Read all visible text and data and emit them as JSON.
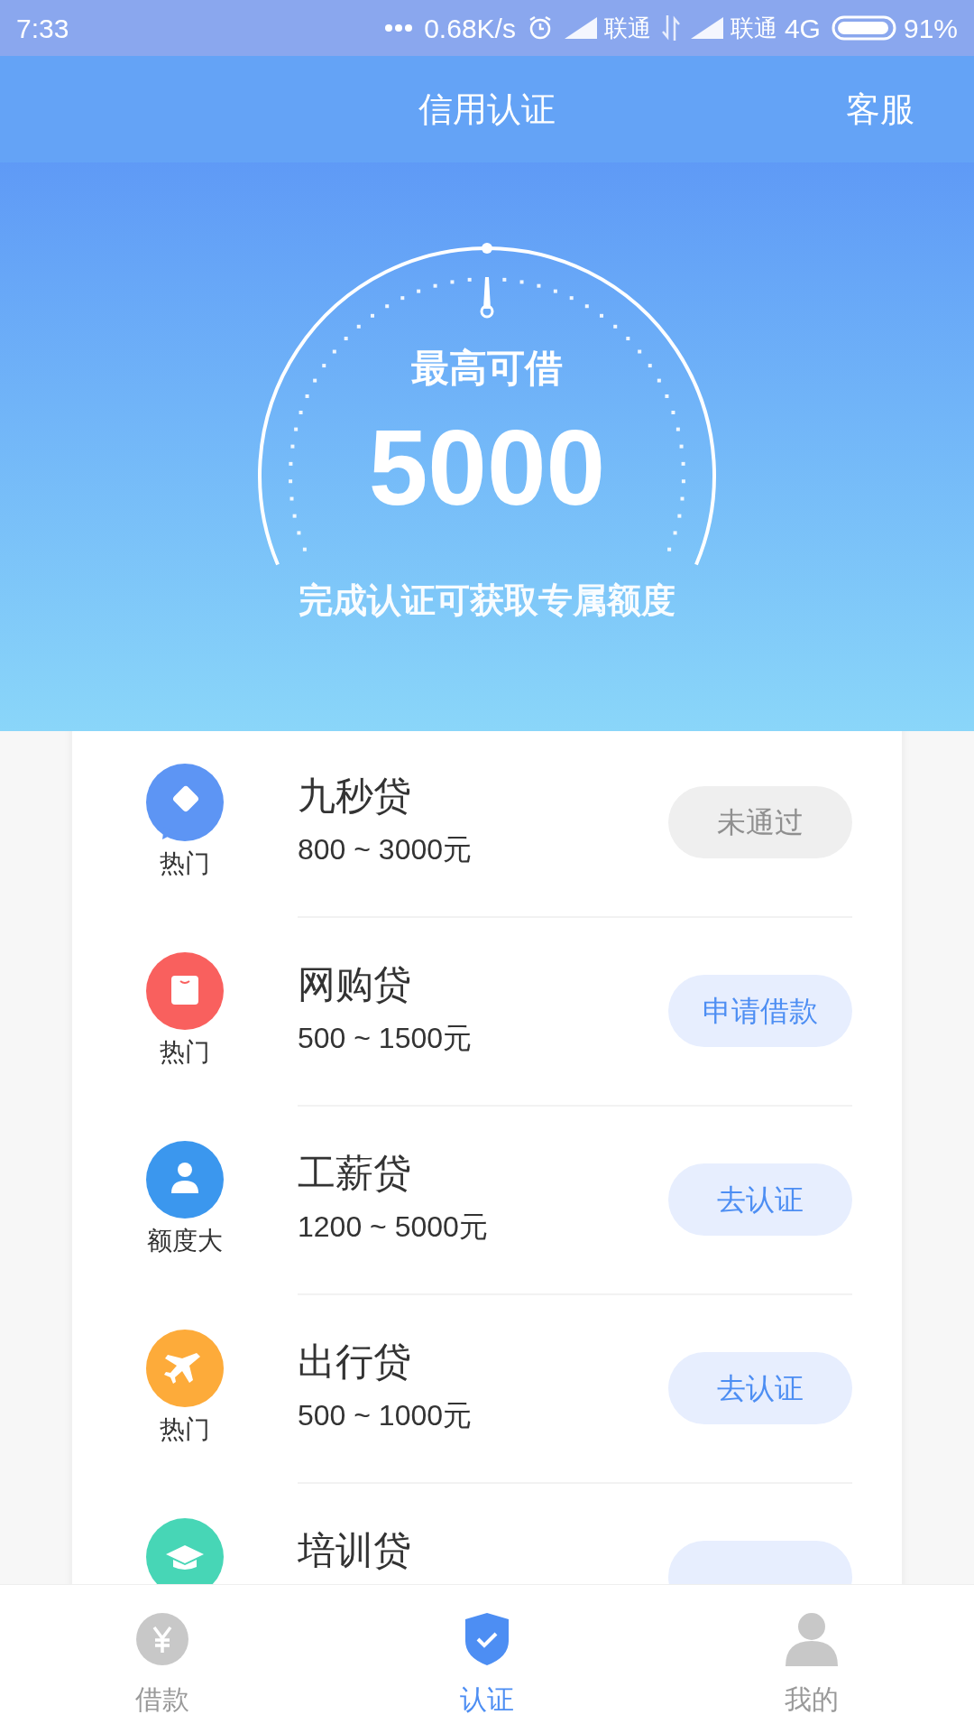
{
  "status_bar": {
    "time": "7:33",
    "speed": "0.68K/s",
    "carrier_1": "联通",
    "carrier_2": "联通",
    "network": "4G",
    "battery": "91%"
  },
  "header": {
    "title": "信用认证",
    "action": "客服"
  },
  "hero": {
    "caption": "最高可借",
    "amount": "5000",
    "subtitle": "完成认证可获取专属额度"
  },
  "loans": [
    {
      "kind": "diamond",
      "color": "#5d95f4",
      "tag": "热门",
      "name": "九秒贷",
      "range": "800 ~ 3000元",
      "button": {
        "kind": "failed",
        "label": "未通过"
      }
    },
    {
      "kind": "bag",
      "color": "#f9605e",
      "tag": "热门",
      "name": "网购贷",
      "range": "500 ~ 1500元",
      "button": {
        "kind": "action",
        "label": "申请借款"
      }
    },
    {
      "kind": "person",
      "color": "#3b97ee",
      "tag": "额度大",
      "name": "工薪贷",
      "range": "1200 ~ 5000元",
      "button": {
        "kind": "action",
        "label": "去认证"
      }
    },
    {
      "kind": "plane",
      "color": "#fdab3a",
      "tag": "热门",
      "name": "出行贷",
      "range": "500 ~ 1000元",
      "button": {
        "kind": "action",
        "label": "去认证"
      }
    },
    {
      "kind": "cap",
      "color": "#47d6b6",
      "name": "培训贷",
      "button": {
        "kind": "action"
      }
    }
  ],
  "tabs": [
    {
      "kind": "loan",
      "label": "借款",
      "selected": false
    },
    {
      "kind": "verify",
      "label": "认证",
      "selected": true
    },
    {
      "kind": "profile",
      "label": "我的",
      "selected": false
    }
  ]
}
